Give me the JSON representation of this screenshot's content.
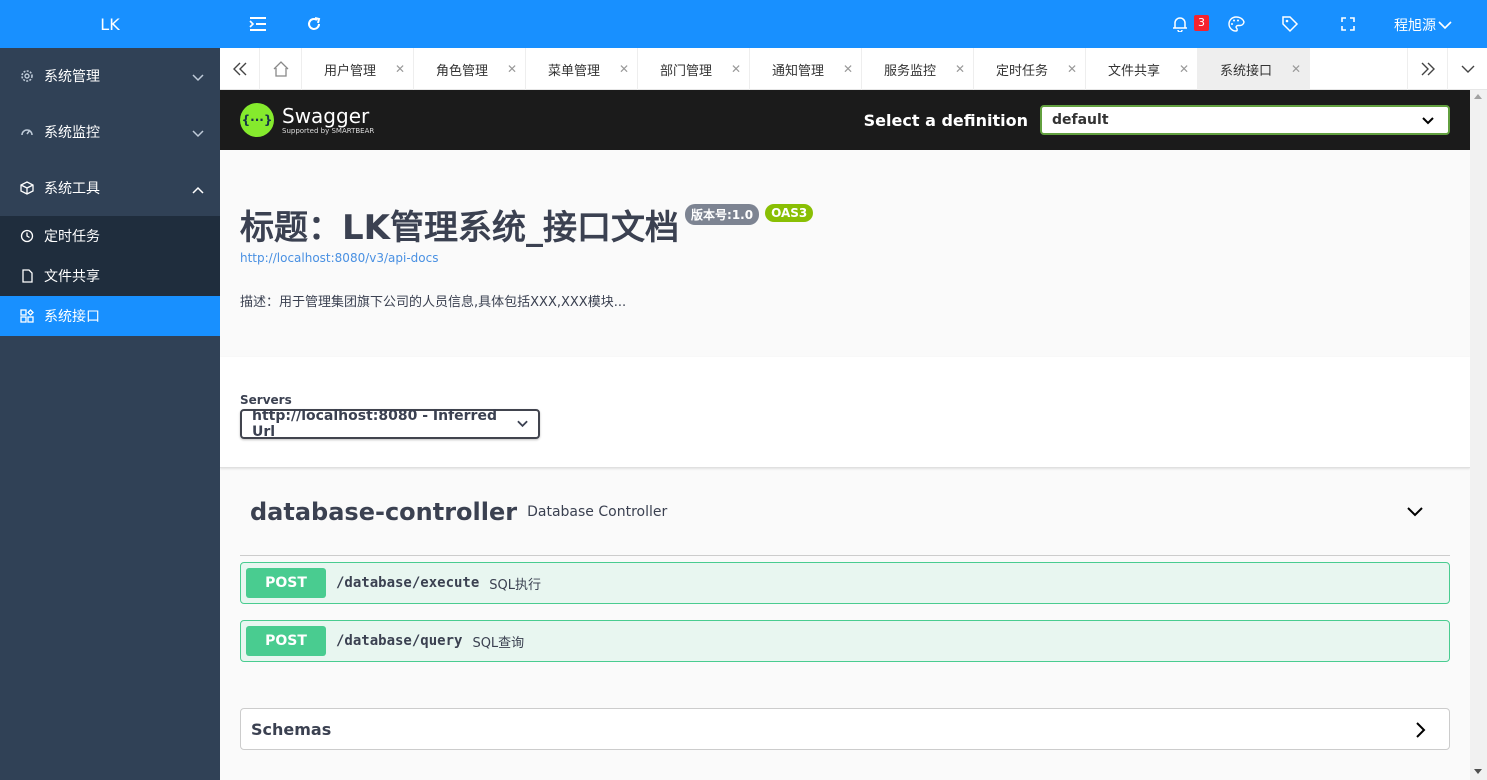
{
  "sidebar": {
    "logo": "LK",
    "menus": [
      {
        "label": "系统管理",
        "icon": "gear-icon"
      },
      {
        "label": "系统监控",
        "icon": "dashboard-icon"
      },
      {
        "label": "系统工具",
        "icon": "cube-icon"
      }
    ],
    "tools_items": [
      {
        "label": "定时任务",
        "icon": "clock-icon"
      },
      {
        "label": "文件共享",
        "icon": "document-icon"
      },
      {
        "label": "系统接口",
        "icon": "apps-icon",
        "active": true
      }
    ]
  },
  "topbar": {
    "notification_count": "3",
    "user_name": "程旭源"
  },
  "tabs": [
    "用户管理",
    "角色管理",
    "菜单管理",
    "部门管理",
    "通知管理",
    "服务监控",
    "定时任务",
    "文件共享",
    "系统接口"
  ],
  "swagger": {
    "brand": "Swagger",
    "brand_sub": "Supported by SMARTBEAR",
    "select_label": "Select a definition",
    "definition": "default",
    "title": "标题：LK管理系统_接口文档",
    "version": "版本号:1.0",
    "oas": "OAS3",
    "url": "http://localhost:8080/v3/api-docs",
    "description": "描述：用于管理集团旗下公司的人员信息,具体包括XXX,XXX模块...",
    "servers_label": "Servers",
    "server": "http://localhost:8080 - Inferred Url",
    "controller": {
      "name": "database-controller",
      "desc": "Database Controller"
    },
    "operations": [
      {
        "method": "POST",
        "path": "/database/execute",
        "summary": "SQL执行"
      },
      {
        "method": "POST",
        "path": "/database/query",
        "summary": "SQL查询"
      }
    ],
    "schemas_label": "Schemas"
  },
  "colors": {
    "primary": "#1890ff",
    "sidebar_bg": "#304156",
    "post_green": "#49cc90",
    "swagger_green": "#85ea2d"
  }
}
